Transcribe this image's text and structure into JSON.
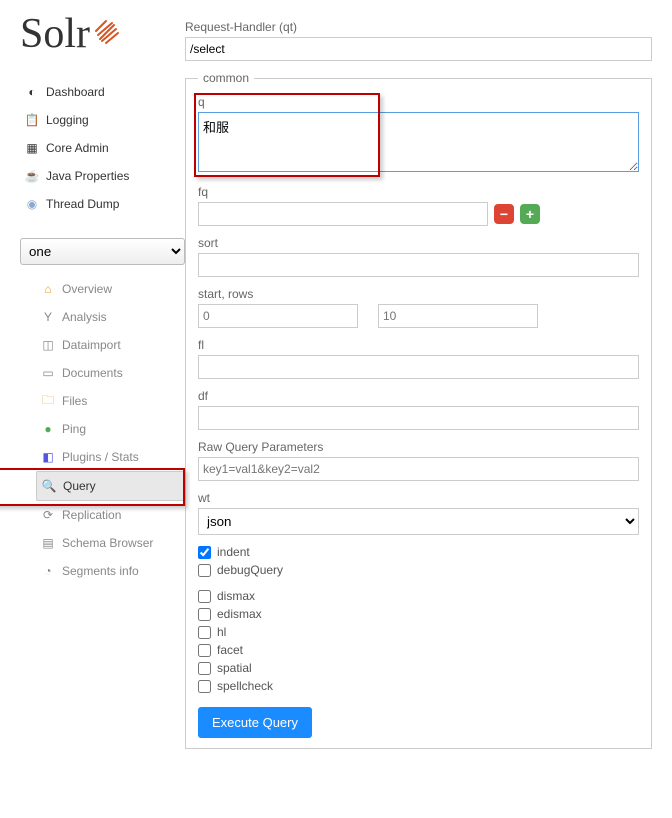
{
  "logo": "Solr",
  "nav": {
    "items": [
      {
        "icon": "📊",
        "label": "Dashboard"
      },
      {
        "icon": "📋",
        "label": "Logging"
      },
      {
        "icon": "⚙",
        "label": "Core Admin"
      },
      {
        "icon": "☕",
        "label": "Java Properties"
      },
      {
        "icon": "🧵",
        "label": "Thread Dump"
      }
    ]
  },
  "core_selector": {
    "selected": "one"
  },
  "subnav": {
    "items": [
      {
        "icon": "🏠",
        "label": "Overview"
      },
      {
        "icon": "🍸",
        "label": "Analysis"
      },
      {
        "icon": "📥",
        "label": "Dataimport"
      },
      {
        "icon": "📄",
        "label": "Documents"
      },
      {
        "icon": "📁",
        "label": "Files"
      },
      {
        "icon": "📶",
        "label": "Ping"
      },
      {
        "icon": "🧩",
        "label": "Plugins / Stats"
      },
      {
        "icon": "🔍",
        "label": "Query",
        "active": true
      },
      {
        "icon": "🔄",
        "label": "Replication"
      },
      {
        "icon": "📘",
        "label": "Schema Browser"
      },
      {
        "icon": "🍕",
        "label": "Segments info"
      }
    ]
  },
  "form": {
    "qt": {
      "label": "Request-Handler (qt)",
      "value": "/select"
    },
    "common_legend": "common",
    "q": {
      "label": "q",
      "value": "和服"
    },
    "fq": {
      "label": "fq",
      "value": ""
    },
    "sort": {
      "label": "sort",
      "value": ""
    },
    "startrows": {
      "label": "start, rows",
      "start_placeholder": "0",
      "rows_placeholder": "10"
    },
    "fl": {
      "label": "fl",
      "value": ""
    },
    "df": {
      "label": "df",
      "value": ""
    },
    "raw": {
      "label": "Raw Query Parameters",
      "placeholder": "key1=val1&key2=val2"
    },
    "wt": {
      "label": "wt",
      "selected": "json"
    },
    "indent": {
      "label": "indent",
      "checked": true
    },
    "debugQuery": {
      "label": "debugQuery",
      "checked": false
    },
    "dismax": {
      "label": "dismax"
    },
    "edismax": {
      "label": "edismax"
    },
    "hl": {
      "label": "hl"
    },
    "facet": {
      "label": "facet"
    },
    "spatial": {
      "label": "spatial"
    },
    "spellcheck": {
      "label": "spellcheck"
    },
    "execute": "Execute Query"
  }
}
